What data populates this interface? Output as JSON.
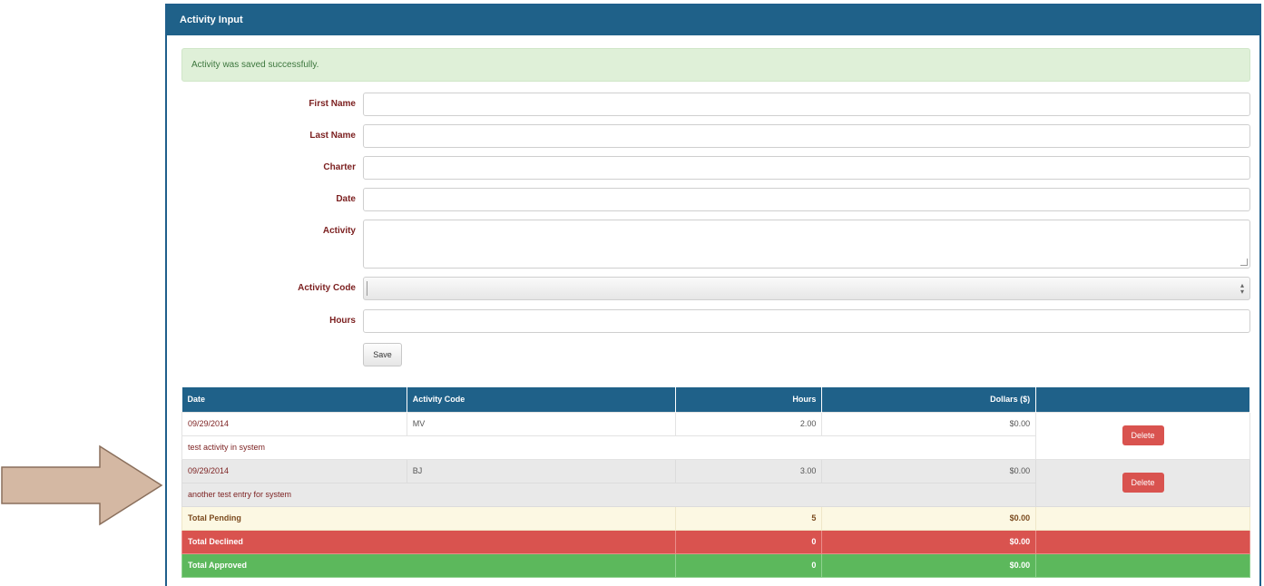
{
  "panel": {
    "title": "Activity Input"
  },
  "alert": {
    "message": "Activity was saved successfully."
  },
  "form": {
    "first_name_label": "First Name",
    "last_name_label": "Last Name",
    "charter_label": "Charter",
    "date_label": "Date",
    "activity_label": "Activity",
    "activity_code_label": "Activity Code",
    "hours_label": "Hours",
    "first_name_value": "",
    "last_name_value": "",
    "charter_value": "",
    "date_value": "",
    "activity_value": "",
    "activity_code_value": "",
    "hours_value": "",
    "save_label": "Save"
  },
  "table": {
    "headers": {
      "date": "Date",
      "activity_code": "Activity Code",
      "hours": "Hours",
      "dollars": "Dollars ($)"
    },
    "rows": [
      {
        "date": "09/29/2014",
        "activity_code": "MV",
        "hours": "2.00",
        "dollars": "$0.00",
        "description": "test activity in system",
        "action": "Delete"
      },
      {
        "date": "09/29/2014",
        "activity_code": "BJ",
        "hours": "3.00",
        "dollars": "$0.00",
        "description": "another test entry for system",
        "action": "Delete"
      }
    ],
    "totals": {
      "pending": {
        "label": "Total Pending",
        "hours": "5",
        "dollars": "$0.00"
      },
      "declined": {
        "label": "Total Declined",
        "hours": "0",
        "dollars": "$0.00"
      },
      "approved": {
        "label": "Total Approved",
        "hours": "0",
        "dollars": "$0.00"
      }
    }
  },
  "colors": {
    "header_blue": "#1f6189",
    "success_bg": "#dff0d8",
    "danger": "#d9534f",
    "success": "#5cb85c",
    "warning_bg": "#fcf8e3",
    "arrow_fill": "#d4b8a3"
  },
  "icons": {
    "arrow": "right-arrow-icon",
    "select": "updown-arrows-icon"
  }
}
